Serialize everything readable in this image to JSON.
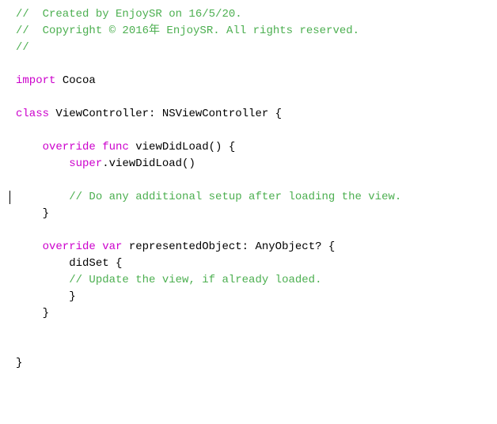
{
  "editor": {
    "background": "#ffffff",
    "lines": [
      {
        "id": 1,
        "content": [
          {
            "text": "//  Created by EnjoySR on 16/5/20.",
            "style": "comment"
          }
        ]
      },
      {
        "id": 2,
        "content": [
          {
            "text": "//  Copyright © 2016年 EnjoySR. All rights reserved.",
            "style": "comment"
          }
        ]
      },
      {
        "id": 3,
        "content": [
          {
            "text": "//",
            "style": "comment"
          }
        ]
      },
      {
        "id": 4,
        "content": []
      },
      {
        "id": 5,
        "content": [
          {
            "text": "import",
            "style": "keyword"
          },
          {
            "text": " Cocoa",
            "style": "default"
          }
        ]
      },
      {
        "id": 6,
        "content": []
      },
      {
        "id": 7,
        "content": [
          {
            "text": "class",
            "style": "keyword"
          },
          {
            "text": " ViewController: NSViewController {",
            "style": "default"
          }
        ]
      },
      {
        "id": 8,
        "content": []
      },
      {
        "id": 9,
        "content": [
          {
            "text": "    override",
            "style": "keyword"
          },
          {
            "text": " ",
            "style": "default"
          },
          {
            "text": "func",
            "style": "keyword"
          },
          {
            "text": " viewDidLoad() {",
            "style": "default"
          }
        ]
      },
      {
        "id": 10,
        "content": [
          {
            "text": "        ",
            "style": "default"
          },
          {
            "text": "super",
            "style": "keyword"
          },
          {
            "text": ".viewDidLoad()",
            "style": "default"
          }
        ]
      },
      {
        "id": 11,
        "content": []
      },
      {
        "id": 12,
        "content": [
          {
            "text": "        ",
            "style": "default"
          },
          {
            "text": "// Do any additional setup after loading the view.",
            "style": "comment"
          }
        ],
        "cursor": true
      },
      {
        "id": 13,
        "content": [
          {
            "text": "    }",
            "style": "default"
          }
        ]
      },
      {
        "id": 14,
        "content": []
      },
      {
        "id": 15,
        "content": [
          {
            "text": "    override",
            "style": "keyword"
          },
          {
            "text": " ",
            "style": "default"
          },
          {
            "text": "var",
            "style": "keyword"
          },
          {
            "text": " representedObject: AnyObject? {",
            "style": "default"
          }
        ]
      },
      {
        "id": 16,
        "content": [
          {
            "text": "        didSet {",
            "style": "default"
          }
        ]
      },
      {
        "id": 17,
        "content": [
          {
            "text": "        ",
            "style": "default"
          },
          {
            "text": "// Update the view, if already loaded.",
            "style": "comment"
          }
        ]
      },
      {
        "id": 18,
        "content": [
          {
            "text": "        }",
            "style": "default"
          }
        ]
      },
      {
        "id": 19,
        "content": [
          {
            "text": "    }",
            "style": "default"
          }
        ]
      },
      {
        "id": 20,
        "content": []
      },
      {
        "id": 21,
        "content": []
      },
      {
        "id": 22,
        "content": [
          {
            "text": "}",
            "style": "default"
          }
        ]
      }
    ]
  }
}
